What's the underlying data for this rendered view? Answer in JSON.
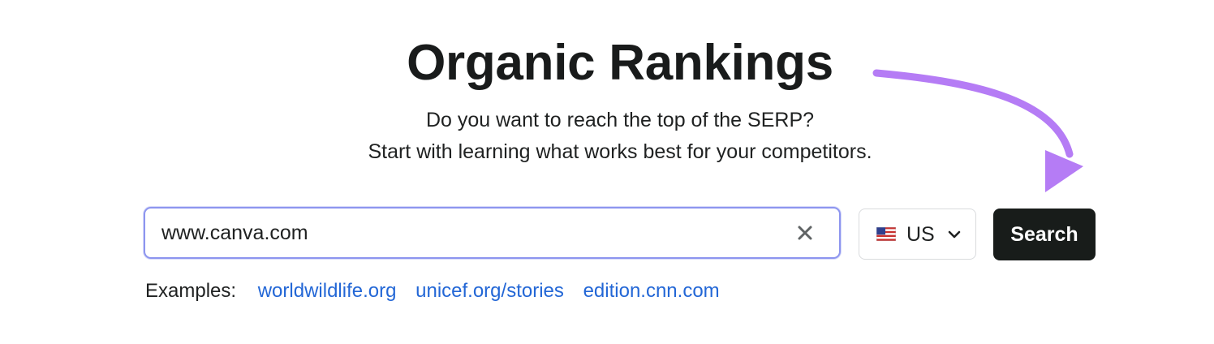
{
  "header": {
    "title": "Organic Rankings",
    "subtitle_line1": "Do you want to reach the top of the SERP?",
    "subtitle_line2": "Start with learning what works best for your competitors."
  },
  "search": {
    "value": "www.canva.com",
    "clear_icon": "close-icon"
  },
  "country": {
    "flag_icon": "us-flag-icon",
    "selected": "US",
    "chevron_icon": "chevron-down-icon"
  },
  "search_button": {
    "label": "Search"
  },
  "examples": {
    "label": "Examples:",
    "links": [
      "worldwildlife.org",
      "unicef.org/stories",
      "edition.cnn.com"
    ]
  },
  "colors": {
    "accent_arrow": "#b57cf5",
    "input_border": "#8d95ef",
    "link": "#2367d6",
    "button_bg": "#181c1a"
  }
}
